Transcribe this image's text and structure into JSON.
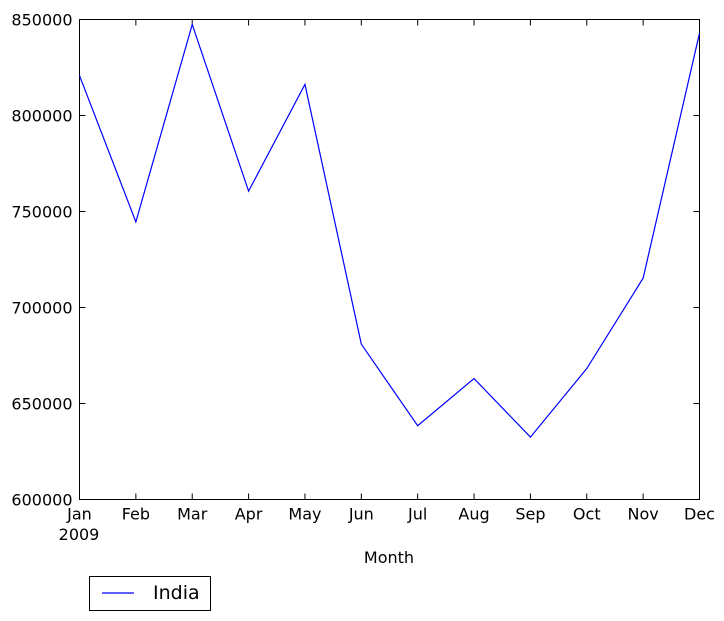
{
  "chart_data": {
    "type": "line",
    "title": "",
    "xlabel": "Month",
    "ylabel": "",
    "categories": [
      "Jan",
      "Feb",
      "Mar",
      "Apr",
      "May",
      "Jun",
      "Jul",
      "Aug",
      "Sep",
      "Oct",
      "Nov",
      "Dec"
    ],
    "x_sublabel": "2009",
    "ylim": [
      600000,
      850000
    ],
    "yticks": [
      600000,
      650000,
      700000,
      750000,
      800000,
      850000
    ],
    "ytick_labels": [
      "600000",
      "650000",
      "700000",
      "750000",
      "800000",
      "850000"
    ],
    "grid": false,
    "legend_position": "below-left",
    "series": [
      {
        "name": "India",
        "color": "#0000ff",
        "values": [
          820800,
          744600,
          847400,
          760600,
          816200,
          680900,
          638400,
          663000,
          632500,
          668200,
          715300,
          842900
        ]
      }
    ]
  }
}
